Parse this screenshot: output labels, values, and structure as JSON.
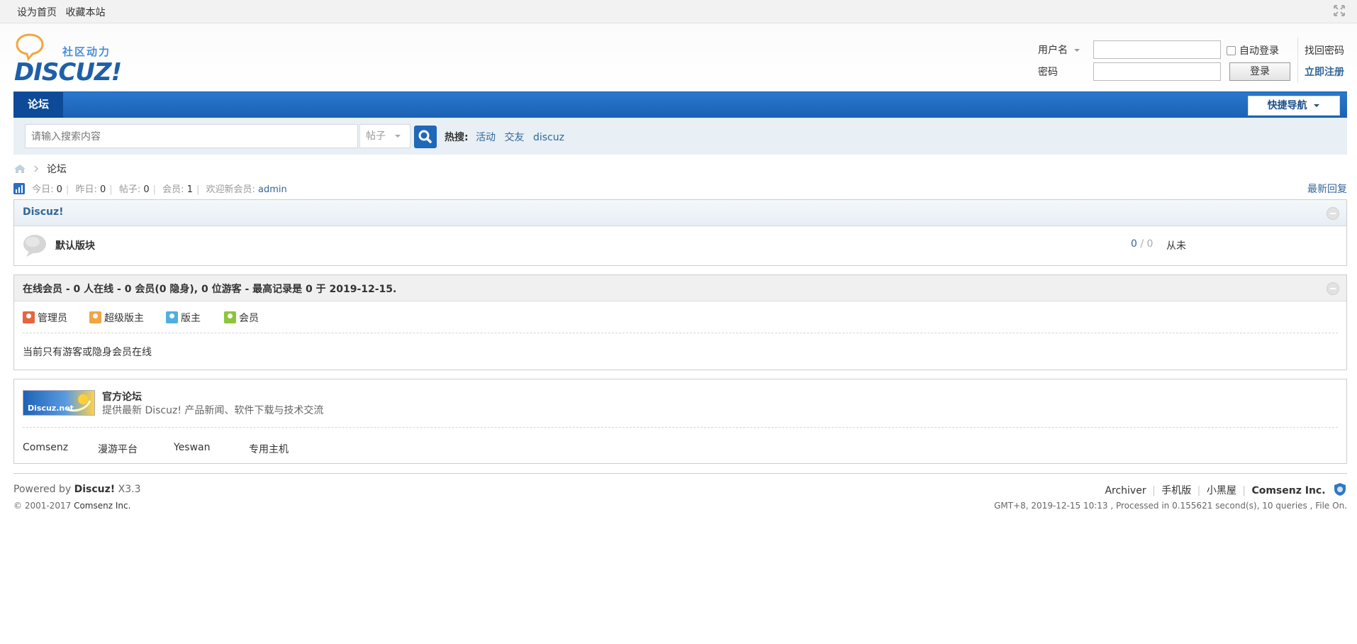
{
  "topbar": {
    "set_home": "设为首页",
    "bookmark": "收藏本站"
  },
  "logo": {
    "brand": "DISCUZ!",
    "slogan": "社区动力"
  },
  "login": {
    "username_label": "用户名",
    "password_label": "密码",
    "auto_login": "自动登录",
    "login_button": "登录",
    "find_password": "找回密码",
    "register": "立即注册"
  },
  "nav": {
    "forum_tab": "论坛",
    "quick_nav": "快捷导航"
  },
  "search": {
    "placeholder": "请输入搜索内容",
    "type_select": "帖子",
    "hot_label": "热搜:",
    "hot_items": [
      "活动",
      "交友",
      "discuz"
    ]
  },
  "breadcrumb": {
    "current": "论坛"
  },
  "stats": {
    "today_label": "今日:",
    "today": "0",
    "yesterday_label": "昨日:",
    "yesterday": "0",
    "posts_label": "帖子:",
    "posts": "0",
    "members_label": "会员:",
    "members": "1",
    "welcome_label": "欢迎新会员:",
    "newest_member": "admin",
    "latest_reply": "最新回复"
  },
  "category": {
    "title": "Discuz!",
    "forum_name": "默认版块",
    "threads": "0",
    "posts": "0",
    "last_post": "从未"
  },
  "online": {
    "title": "在线会员 - 0 人在线 - 0 会员(0 隐身), 0 位游客 - 最高记录是 0 于 2019-12-15.",
    "legend": [
      {
        "label": "管理员",
        "color": "#e8643c"
      },
      {
        "label": "超级版主",
        "color": "#f3a444"
      },
      {
        "label": "版主",
        "color": "#4fb0e0"
      },
      {
        "label": "会员",
        "color": "#8dc53e"
      }
    ],
    "note": "当前只有游客或隐身会员在线"
  },
  "official": {
    "logo_text": "Discuz.net",
    "title": "官方论坛",
    "desc": "提供最新 Discuz! 产品新闻、软件下载与技术交流",
    "links": [
      "Comsenz",
      "漫游平台",
      "Yeswan",
      "专用主机"
    ]
  },
  "footer": {
    "powered_prefix": "Powered by",
    "powered_name": "Discuz!",
    "version": "X3.3",
    "copyright": "© 2001-2017",
    "copyright_company": "Comsenz Inc.",
    "links": [
      "Archiver",
      "手机版",
      "小黑屋"
    ],
    "company": "Comsenz Inc.",
    "debug": "GMT+8, 2019-12-15 10:13 , Processed in 0.155621 second(s), 10 queries , File On."
  }
}
